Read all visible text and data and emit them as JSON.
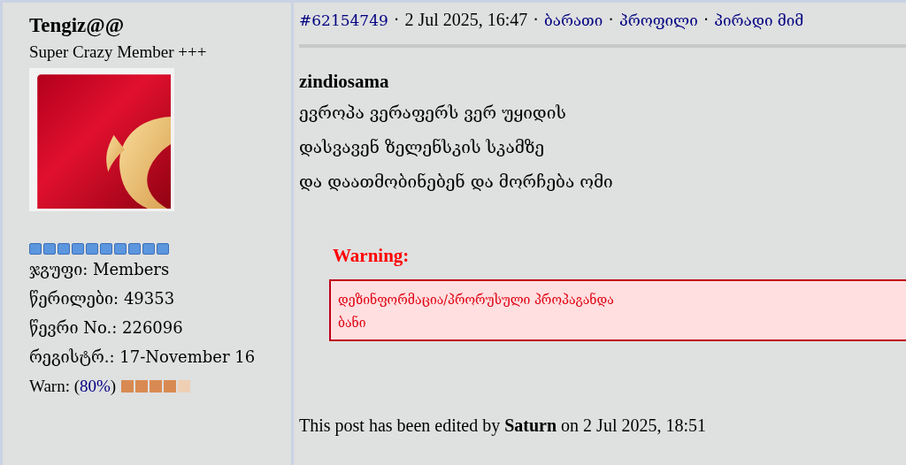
{
  "user": {
    "name": "Tengiz@@",
    "title": "Super Crazy Member +++",
    "stats": [
      "ჯგუფი: Members",
      "წერილები: 49353",
      "წევრი No.: 226096",
      "რეგისტრ.: 17-November 16"
    ],
    "warn": {
      "prefix": "Warn: (",
      "percent": "80%",
      "suffix": ")",
      "level": 0.8
    }
  },
  "header": [
    {
      "kind": "link",
      "text": "#62154749"
    },
    {
      "kind": "sep",
      "text": "·"
    },
    {
      "kind": "text",
      "text": "2 Jul 2025, 16:47"
    },
    {
      "kind": "sep",
      "text": "·"
    },
    {
      "kind": "link",
      "text": "ბარათი"
    },
    {
      "kind": "sep",
      "text": "·"
    },
    {
      "kind": "link",
      "text": "პროფილი"
    },
    {
      "kind": "sep",
      "text": "·"
    },
    {
      "kind": "link",
      "text": "პირადი მიმ"
    }
  ],
  "post": {
    "title": "zindiosama",
    "lines": [
      "ევროპა ვერაფერს ვერ უყიდის",
      "დასვავენ ზელენსკის სკამზე",
      "და დაათმობინებენ და მორჩება ომი"
    ]
  },
  "warning": {
    "heading": "Warning:",
    "lines": [
      "დეზინფორმაცია/პრორუსული პროპაგანდა",
      "ბანი"
    ]
  },
  "edited": "This post has been edited by **Saturn** on 2 Jul 2025, 18:51"
}
